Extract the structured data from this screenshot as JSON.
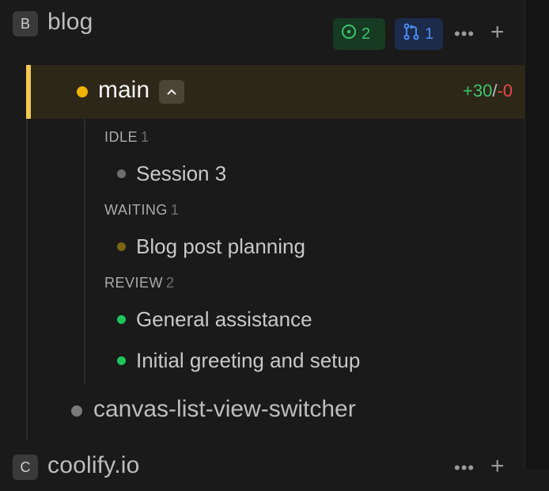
{
  "projects": [
    {
      "avatar": "B",
      "name": "blog",
      "issues_count": "2",
      "prs_count": "1",
      "more_icon": "more-icon",
      "add_icon": "plus-icon"
    },
    {
      "avatar": "C",
      "name": "coolify.io"
    }
  ],
  "branch": {
    "name": "main",
    "collapse_icon": "chevron-up-icon",
    "diff_added": "+30",
    "diff_sep": "/",
    "diff_removed": "-0",
    "status_color": "#f0b400"
  },
  "groups": [
    {
      "label": "IDLE",
      "count": "1",
      "sessions": [
        {
          "label": "Session 3",
          "dot_color": "#6e6e6e"
        }
      ]
    },
    {
      "label": "WAITING",
      "count": "1",
      "sessions": [
        {
          "label": "Blog post planning",
          "dot_color": "#7a6412"
        }
      ]
    },
    {
      "label": "REVIEW",
      "count": "2",
      "sessions": [
        {
          "label": "General assistance",
          "dot_color": "#1fc45a"
        },
        {
          "label": "Initial greeting and setup",
          "dot_color": "#1fc45a"
        }
      ]
    }
  ],
  "branch2": {
    "name": "canvas-list-view-switcher"
  }
}
